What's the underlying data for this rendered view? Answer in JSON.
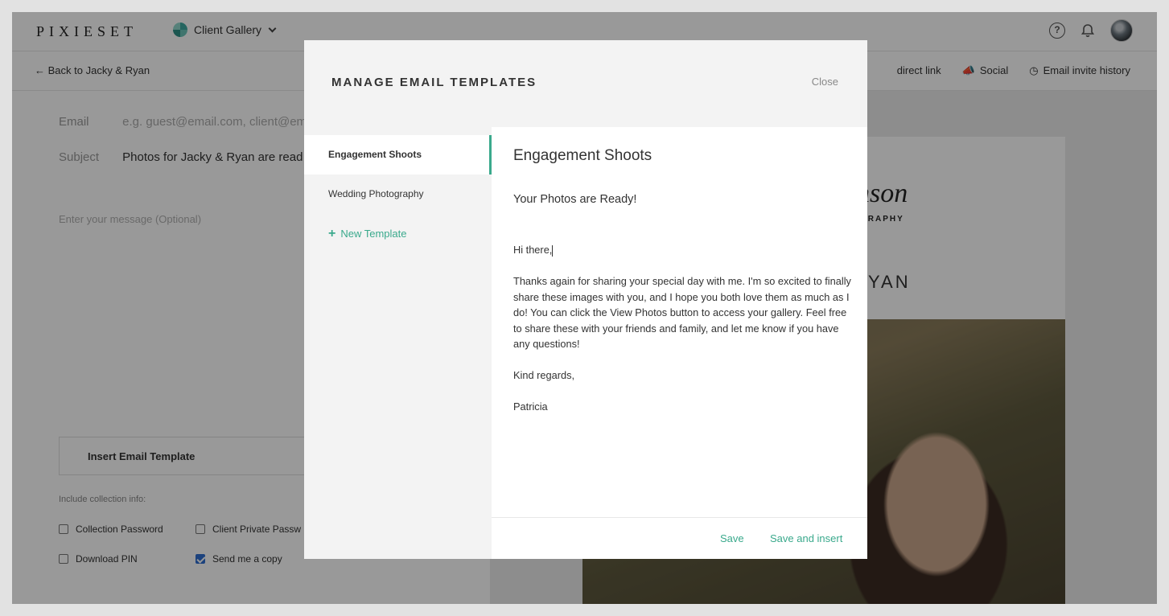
{
  "app": {
    "logo": "PIXIESET",
    "switcher": "Client Gallery"
  },
  "subbar": {
    "back": "Back to Jacky & Ryan",
    "actions": [
      "direct link",
      "Social",
      "Email invite history"
    ]
  },
  "compose": {
    "email_label": "Email",
    "email_placeholder": "e.g. guest@email.com, client@em",
    "subject_label": "Subject",
    "subject_value": "Photos for Jacky & Ryan are read",
    "message_placeholder": "Enter your message (Optional)",
    "insert_template": "Insert Email Template",
    "include_label": "Include collection info:",
    "checkboxes": [
      {
        "label": "Collection Password",
        "checked": false
      },
      {
        "label": "Client Private Passw",
        "checked": false
      },
      {
        "label": "Download PIN",
        "checked": false
      },
      {
        "label": "Send me a copy",
        "checked": true
      }
    ]
  },
  "preview": {
    "brand": "nson",
    "sub": "GRAPHY",
    "title": "YAN"
  },
  "modal": {
    "title": "MANAGE EMAIL TEMPLATES",
    "close": "Close",
    "templates": [
      "Engagement Shoots",
      "Wedding Photography"
    ],
    "new_template": "New Template",
    "editor": {
      "title": "Engagement Shoots",
      "subject": "Your Photos are Ready!",
      "body": [
        "Hi there,",
        "Thanks again for sharing your special day with me. I'm so excited to finally share these images with you, and I hope you both love them as much as I do! You can click the View Photos button to access your gallery. Feel free to share these with your friends and family, and let me know if you have any questions!",
        "Kind regards,",
        "Patricia"
      ],
      "save": "Save",
      "save_insert": "Save and insert"
    }
  }
}
